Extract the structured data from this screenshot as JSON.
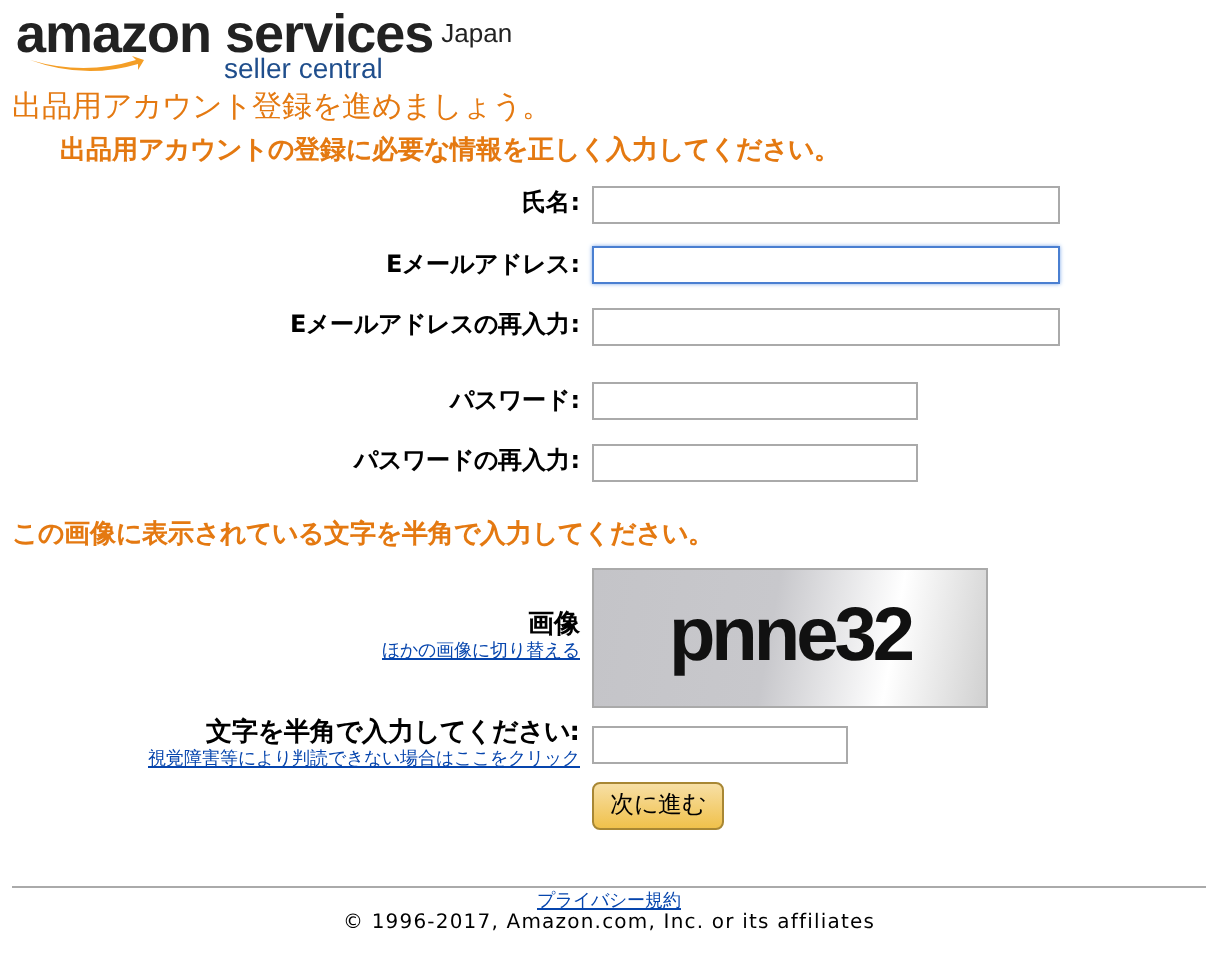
{
  "logo": {
    "brand": "amazon services",
    "region": "Japan",
    "product": "seller central"
  },
  "heading": "出品用アカウント登録を進めましょう。",
  "subheading": "出品用アカウントの登録に必要な情報を正しく入力してください。",
  "account_fields": [
    {
      "label": "氏名:",
      "kind": "wide",
      "focused": false
    },
    {
      "label": "Eメールアドレス:",
      "kind": "wide",
      "focused": true
    },
    {
      "label": "Eメールアドレスの再入力:",
      "kind": "wide",
      "focused": false
    }
  ],
  "password_fields": [
    {
      "label": "パスワード:",
      "kind": "narrow",
      "focused": false
    },
    {
      "label": "パスワードの再入力:",
      "kind": "narrow",
      "focused": false
    }
  ],
  "captcha": {
    "heading": "この画像に表示されている文字を半角で入力してください。",
    "image_label": "画像",
    "refresh_link": "ほかの画像に切り替える",
    "image_text": "pnne32",
    "input_label": "文字を半角で入力してください:",
    "help_link": "視覚障害等により判読できない場合はここをクリック"
  },
  "submit_button": "次に進む",
  "footer": {
    "privacy_link": "プライバシー規約",
    "copyright": "© 1996-2017, Amazon.com, Inc. or its affiliates"
  }
}
